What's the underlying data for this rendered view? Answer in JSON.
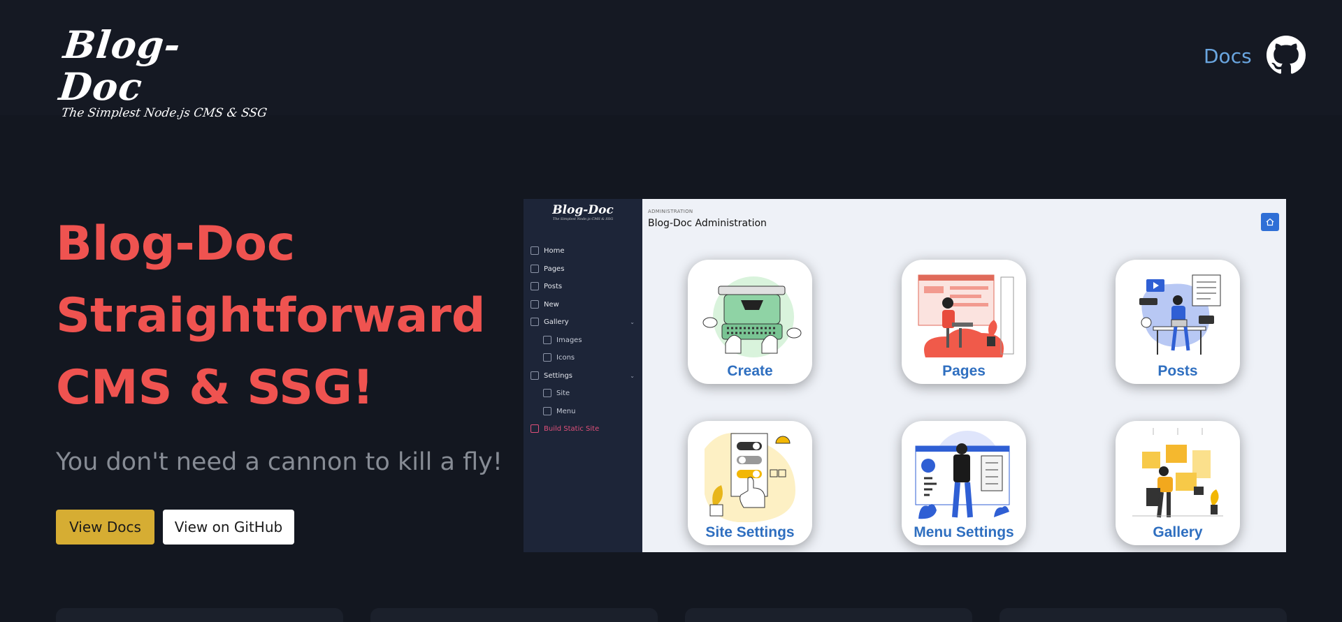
{
  "header": {
    "logo_title": "Blog-Doc",
    "logo_subtitle": "The Simplest Node.js CMS & SSG",
    "nav_docs": "Docs",
    "github_icon": "github-icon"
  },
  "hero": {
    "title_lines": [
      "Blog-Doc",
      "Straightforward",
      "CMS & SSG!"
    ],
    "tagline": "You don't need a cannon to kill a fly!",
    "btn_docs": "View Docs",
    "btn_github": "View on GitHub"
  },
  "preview": {
    "logo_title": "Blog-Doc",
    "logo_subtitle": "The Simplest Node.js CMS & SSG",
    "sidebar": {
      "items": [
        {
          "label": "Home",
          "icon": "home-icon"
        },
        {
          "label": "Pages",
          "icon": "page-icon"
        },
        {
          "label": "Posts",
          "icon": "post-icon"
        },
        {
          "label": "New",
          "icon": "new-icon"
        },
        {
          "label": "Gallery",
          "icon": "gallery-icon"
        },
        {
          "label": "Images",
          "icon": "image-icon"
        },
        {
          "label": "Icons",
          "icon": "icons-icon"
        },
        {
          "label": "Settings",
          "icon": "settings-icon"
        },
        {
          "label": "Site",
          "icon": "globe-icon"
        },
        {
          "label": "Menu",
          "icon": "menu-icon"
        },
        {
          "label": "Build Static Site",
          "icon": "hammer-icon"
        }
      ]
    },
    "breadcrumb": "ADMINISTRATION",
    "heading": "Blog-Doc Administration",
    "tiles": [
      {
        "label": "Create"
      },
      {
        "label": "Pages"
      },
      {
        "label": "Posts"
      },
      {
        "label": "Site Settings"
      },
      {
        "label": "Menu Settings"
      },
      {
        "label": "Gallery"
      }
    ]
  },
  "colors": {
    "accent_red": "#ef5350",
    "docs_blue": "#6aa6e0",
    "button_gold": "#d6ad33",
    "background": "#131720"
  }
}
